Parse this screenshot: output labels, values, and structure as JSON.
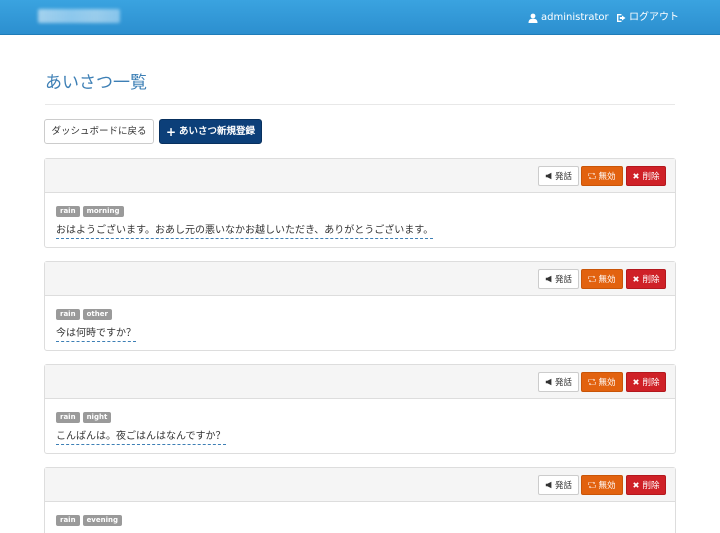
{
  "header": {
    "user": "administrator",
    "logout": "ログアウト"
  },
  "page": {
    "title": "あいさつ一覧"
  },
  "toolbar": {
    "back_label": "ダッシュボードに戻る",
    "new_label": "あいさつ新規登録"
  },
  "card_actions": {
    "speak": "発話",
    "disable": "無効",
    "delete": "削除"
  },
  "greetings": [
    {
      "tags": [
        "rain",
        "morning"
      ],
      "text": "おはようございます。おあし元の悪いなかお越しいただき、ありがとうございます。"
    },
    {
      "tags": [
        "rain",
        "other"
      ],
      "text": "今は何時ですか？"
    },
    {
      "tags": [
        "rain",
        "night"
      ],
      "text": "こんばんは。夜ごはんはなんですか？"
    },
    {
      "tags": [
        "rain",
        "evening"
      ],
      "text": ""
    }
  ],
  "colors": {
    "navbar": "#2c8fcf",
    "title": "#3d7fb5",
    "primary": "#0c3f79",
    "warning": "#e2620f",
    "danger": "#cf2127",
    "tag": "#9a9a9a"
  }
}
